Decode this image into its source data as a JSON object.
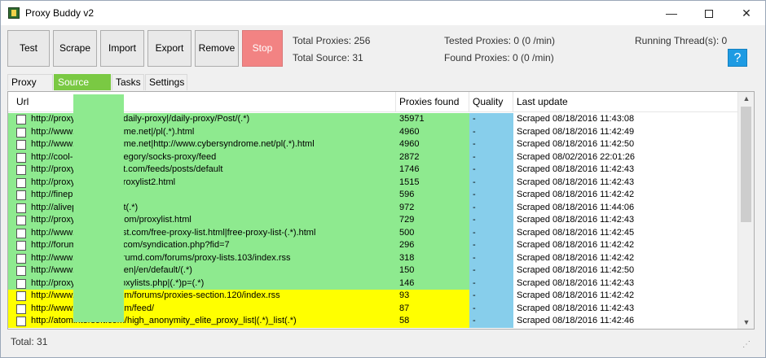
{
  "window": {
    "title": "Proxy Buddy v2"
  },
  "toolbar": {
    "buttons": [
      {
        "label": "Test"
      },
      {
        "label": "Scrape"
      },
      {
        "label": "Import"
      },
      {
        "label": "Export"
      },
      {
        "label": "Remove"
      },
      {
        "label": "Stop"
      }
    ]
  },
  "stats": {
    "total_proxies": "Total Proxies: 256",
    "total_source": "Total Source: 31",
    "tested_proxies": "Tested Proxies: 0 (0 /min)",
    "found_proxies": "Found Proxies: 0 (0 /min)",
    "running_threads": "Running Thread(s): 0"
  },
  "help_label": "?",
  "tabs": [
    {
      "label": "Proxy List"
    },
    {
      "label": "Source List",
      "active": true
    },
    {
      "label": "Tasks"
    },
    {
      "label": "Settings"
    }
  ],
  "table": {
    "columns": [
      "Url",
      "Proxies found",
      "Quality",
      "Last update"
    ],
    "rows": [
      {
        "url": "http://proxydb.ru/en-us/daily-proxy|/daily-proxy/Post/(.*)",
        "found": "35971",
        "quality": "-",
        "update": "Scraped 08/18/2016 11:43:08",
        "color": "#8eea8f"
      },
      {
        "url": "http://www.cybersyndrome.net|/pl(.*).html",
        "found": "4960",
        "quality": "-",
        "update": "Scraped 08/18/2016 11:42:49",
        "color": "#8eea8f"
      },
      {
        "url": "http://www.cybersyndrome.net|http://www.cybersyndrome.net/pl(.*).html",
        "found": "4960",
        "quality": "-",
        "update": "Scraped 08/18/2016 11:42:50",
        "color": "#8eea8f"
      },
      {
        "url": "http://cool-proxy.net/category/socks-proxy/feed",
        "found": "2872",
        "quality": "-",
        "update": "Scraped 08/02/2016 22:01:26",
        "color": "#8eea8f"
      },
      {
        "url": "http://proxy-list.blogspot.com/feeds/posts/default",
        "found": "1746",
        "quality": "-",
        "update": "Scraped 08/18/2016 11:42:43",
        "color": "#8eea8f"
      },
      {
        "url": "http://proxy-daily.com/proxylist2.html",
        "found": "1515",
        "quality": "-",
        "update": "Scraped 08/18/2016 11:42:43",
        "color": "#8eea8f"
      },
      {
        "url": "http://fineproxy.org/",
        "found": "596",
        "quality": "-",
        "update": "Scraped 08/18/2016 11:42:42",
        "color": "#8eea8f"
      },
      {
        "url": "http://aliveproxy.com/list(.*)",
        "found": "972",
        "quality": "-",
        "update": "Scraped 08/18/2016 11:44:06",
        "color": "#8eea8f"
      },
      {
        "url": "http://proxy-server-list.com/proxylist.html",
        "found": "729",
        "quality": "-",
        "update": "Scraped 08/18/2016 11:42:43",
        "color": "#8eea8f"
      },
      {
        "url": "http://www.free-proxy-list.com/free-proxy-list.html|free-proxy-list-(.*).html",
        "found": "500",
        "quality": "-",
        "update": "Scraped 08/18/2016 11:42:45",
        "color": "#8eea8f"
      },
      {
        "url": "http://forums.proxylists.com/syndication.php?fid=7",
        "found": "296",
        "quality": "-",
        "update": "Scraped 08/18/2016 11:42:42",
        "color": "#8eea8f"
      },
      {
        "url": "http://www.proxylists.forumd.com/forums/proxy-lists.103/index.rss",
        "found": "318",
        "quality": "-",
        "update": "Scraped 08/18/2016 11:42:42",
        "color": "#8eea8f"
      },
      {
        "url": "http://www.proxies.gen/en|/en/default/(.*)",
        "found": "150",
        "quality": "-",
        "update": "Scraped 08/18/2016 11:42:50",
        "color": "#8eea8f"
      },
      {
        "url": "http://proxylists.blog/proxylists.php|(.*)p=(.*)",
        "found": "146",
        "quality": "-",
        "update": "Scraped 08/18/2016 11:42:43",
        "color": "#8eea8f"
      },
      {
        "url": "http://www.proxylists.com/forums/proxies-section.120/index.rss",
        "found": "93",
        "quality": "-",
        "update": "Scraped 08/18/2016 11:42:42",
        "color": "#ffff00"
      },
      {
        "url": "http://www.proxylists.com/feed/",
        "found": "87",
        "quality": "-",
        "update": "Scraped 08/18/2016 11:42:43",
        "color": "#ffff00"
      },
      {
        "url": "http://atomintersoft.com/high_anonymity_elite_proxy_list|(.*)_list(.*)",
        "found": "58",
        "quality": "-",
        "update": "Scraped 08/18/2016 11:42:46",
        "color": "#ffff00"
      }
    ]
  },
  "status": {
    "total": "Total:  31"
  }
}
